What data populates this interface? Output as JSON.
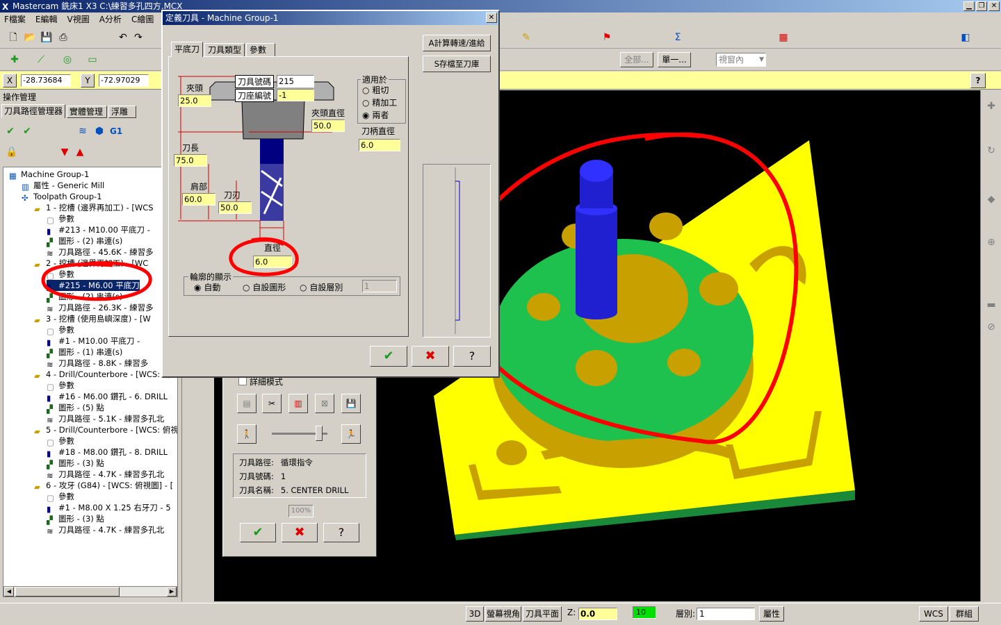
{
  "app": {
    "title": "Mastercam 銑床1 X3  C:\\練習多孔四方.MCX"
  },
  "menu": [
    "F檔案",
    "E編輯",
    "V視圖",
    "A分析",
    "C繪圖"
  ],
  "coords": {
    "x_label": "X",
    "x_value": "-28.73684",
    "y_label": "Y",
    "y_value": "-72.97029"
  },
  "toolbar2": {
    "all_label": "全部...",
    "single_label": "單一...",
    "window_label": "視窗內"
  },
  "opmanager": {
    "title": "操作管理",
    "tabs": [
      "刀具路徑管理器",
      "實體管理",
      "浮雕"
    ]
  },
  "tree": [
    {
      "text": "Machine Group-1",
      "indent": 0,
      "icon": "machine"
    },
    {
      "text": "屬性 - Generic Mill",
      "indent": 1,
      "icon": "props"
    },
    {
      "text": "Toolpath Group-1",
      "indent": 1,
      "icon": "group"
    },
    {
      "text": "1 - 挖槽 (邊界再加工) - [WCS",
      "indent": 2,
      "icon": "folder"
    },
    {
      "text": "參數",
      "indent": 3,
      "icon": "file"
    },
    {
      "text": "#213 - M10.00 平底刀 -",
      "indent": 3,
      "icon": "tool"
    },
    {
      "text": "圖形 - (2) 串連(s)",
      "indent": 3,
      "icon": "geom"
    },
    {
      "text": "刀具路徑 - 45.6K - 練習多",
      "indent": 3,
      "icon": "path"
    },
    {
      "text": "2 - 挖槽 (邊界再加工) - [WC",
      "indent": 2,
      "icon": "folder"
    },
    {
      "text": "參數",
      "indent": 3,
      "icon": "file"
    },
    {
      "text": "#215 - M6.00 平底刀",
      "indent": 3,
      "icon": "tool",
      "selected": true
    },
    {
      "text": "圖形 - (2) 串連(s)",
      "indent": 3,
      "icon": "geom"
    },
    {
      "text": "刀具路徑 - 26.3K - 練習多",
      "indent": 3,
      "icon": "path"
    },
    {
      "text": "3 - 挖槽 (使用島嶼深度) - [W",
      "indent": 2,
      "icon": "folder"
    },
    {
      "text": "參數",
      "indent": 3,
      "icon": "file"
    },
    {
      "text": "#1 - M10.00 平底刀 -",
      "indent": 3,
      "icon": "tool"
    },
    {
      "text": "圖形 - (1) 串連(s)",
      "indent": 3,
      "icon": "geom"
    },
    {
      "text": "刀具路徑 - 8.8K - 練習多",
      "indent": 3,
      "icon": "path"
    },
    {
      "text": "4 - Drill/Counterbore - [WCS: 俯",
      "indent": 2,
      "icon": "folder"
    },
    {
      "text": "參數",
      "indent": 3,
      "icon": "file"
    },
    {
      "text": "#16 - M6.00 鑽孔 -    6. DRILL",
      "indent": 3,
      "icon": "tool"
    },
    {
      "text": "圖形 - (5) 點",
      "indent": 3,
      "icon": "geom"
    },
    {
      "text": "刀具路徑 - 5.1K - 練習多孔北",
      "indent": 3,
      "icon": "path"
    },
    {
      "text": "5 - Drill/Counterbore - [WCS: 俯視圖",
      "indent": 2,
      "icon": "folder"
    },
    {
      "text": "參數",
      "indent": 3,
      "icon": "file"
    },
    {
      "text": "#18 - M8.00 鑽孔 -    8. DRILL",
      "indent": 3,
      "icon": "tool"
    },
    {
      "text": "圖形 - (3) 點",
      "indent": 3,
      "icon": "geom"
    },
    {
      "text": "刀具路徑 - 4.7K - 練習多孔北",
      "indent": 3,
      "icon": "path"
    },
    {
      "text": "6 - 攻牙 (G84) - [WCS: 俯視圖] - [",
      "indent": 2,
      "icon": "folder"
    },
    {
      "text": "參數",
      "indent": 3,
      "icon": "file"
    },
    {
      "text": "#1 - M8.00 X 1.25 右牙刀 -   5",
      "indent": 3,
      "icon": "tool"
    },
    {
      "text": "圖形 - (3) 點",
      "indent": 3,
      "icon": "geom"
    },
    {
      "text": "刀具路徑 - 4.7K - 練習多孔北",
      "indent": 3,
      "icon": "path"
    }
  ],
  "dialog": {
    "title": "定義刀具 - Machine Group-1",
    "tabs": [
      "平底刀",
      "刀具類型",
      "參數"
    ],
    "tool_number_label": "刀具號碼",
    "tool_number": "215",
    "holder_number_label": "刀座編號",
    "holder_number": "-1",
    "chuck_label": "夾頭",
    "chuck": "25.0",
    "chuck_dia_label": "夾頭直徑",
    "chuck_dia": "50.0",
    "shank_dia_label": "刀柄直徑",
    "shank_dia": "6.0",
    "length_label": "刀長",
    "length": "75.0",
    "shoulder_label": "肩部",
    "shoulder": "60.0",
    "flute_label": "刀刃",
    "flute": "50.0",
    "diameter_label": "直徑",
    "diameter": "6.0",
    "apply_label": "適用於",
    "apply_options": [
      "粗切",
      "精加工",
      "兩者"
    ],
    "profile_label": "輪廓的顯示",
    "profile_options": [
      "自動",
      "自設圖形",
      "自設層別"
    ],
    "profile_level": "1",
    "calc_button": "A計算轉速/進給",
    "save_button": "S存檔至刀庫"
  },
  "sim": {
    "verbose_label": "詳細模式",
    "info_rows": [
      [
        "刀具路徑:",
        "循環指令"
      ],
      [
        "刀具號碼:",
        "1"
      ],
      [
        "刀具名稱:",
        "5. CENTER DRILL"
      ]
    ],
    "percent": "100%",
    "speed_fraction": 0.85
  },
  "status": {
    "view3d": "3D",
    "screen_view": "螢幕視角",
    "tool_plane": "刀具平面",
    "z_label": "Z:",
    "z_value": "0.0",
    "color_value": "10",
    "level_label": "層別:",
    "level_value": "1",
    "attrib": "屬性",
    "wcs": "WCS",
    "group": "群組"
  },
  "colors": {
    "plate": "#ffff00",
    "ring": "#1ec14e",
    "boss": "#c8a000",
    "tool": "#2020d0",
    "annot": "#ff0000",
    "title_grad": "#0a246a"
  }
}
